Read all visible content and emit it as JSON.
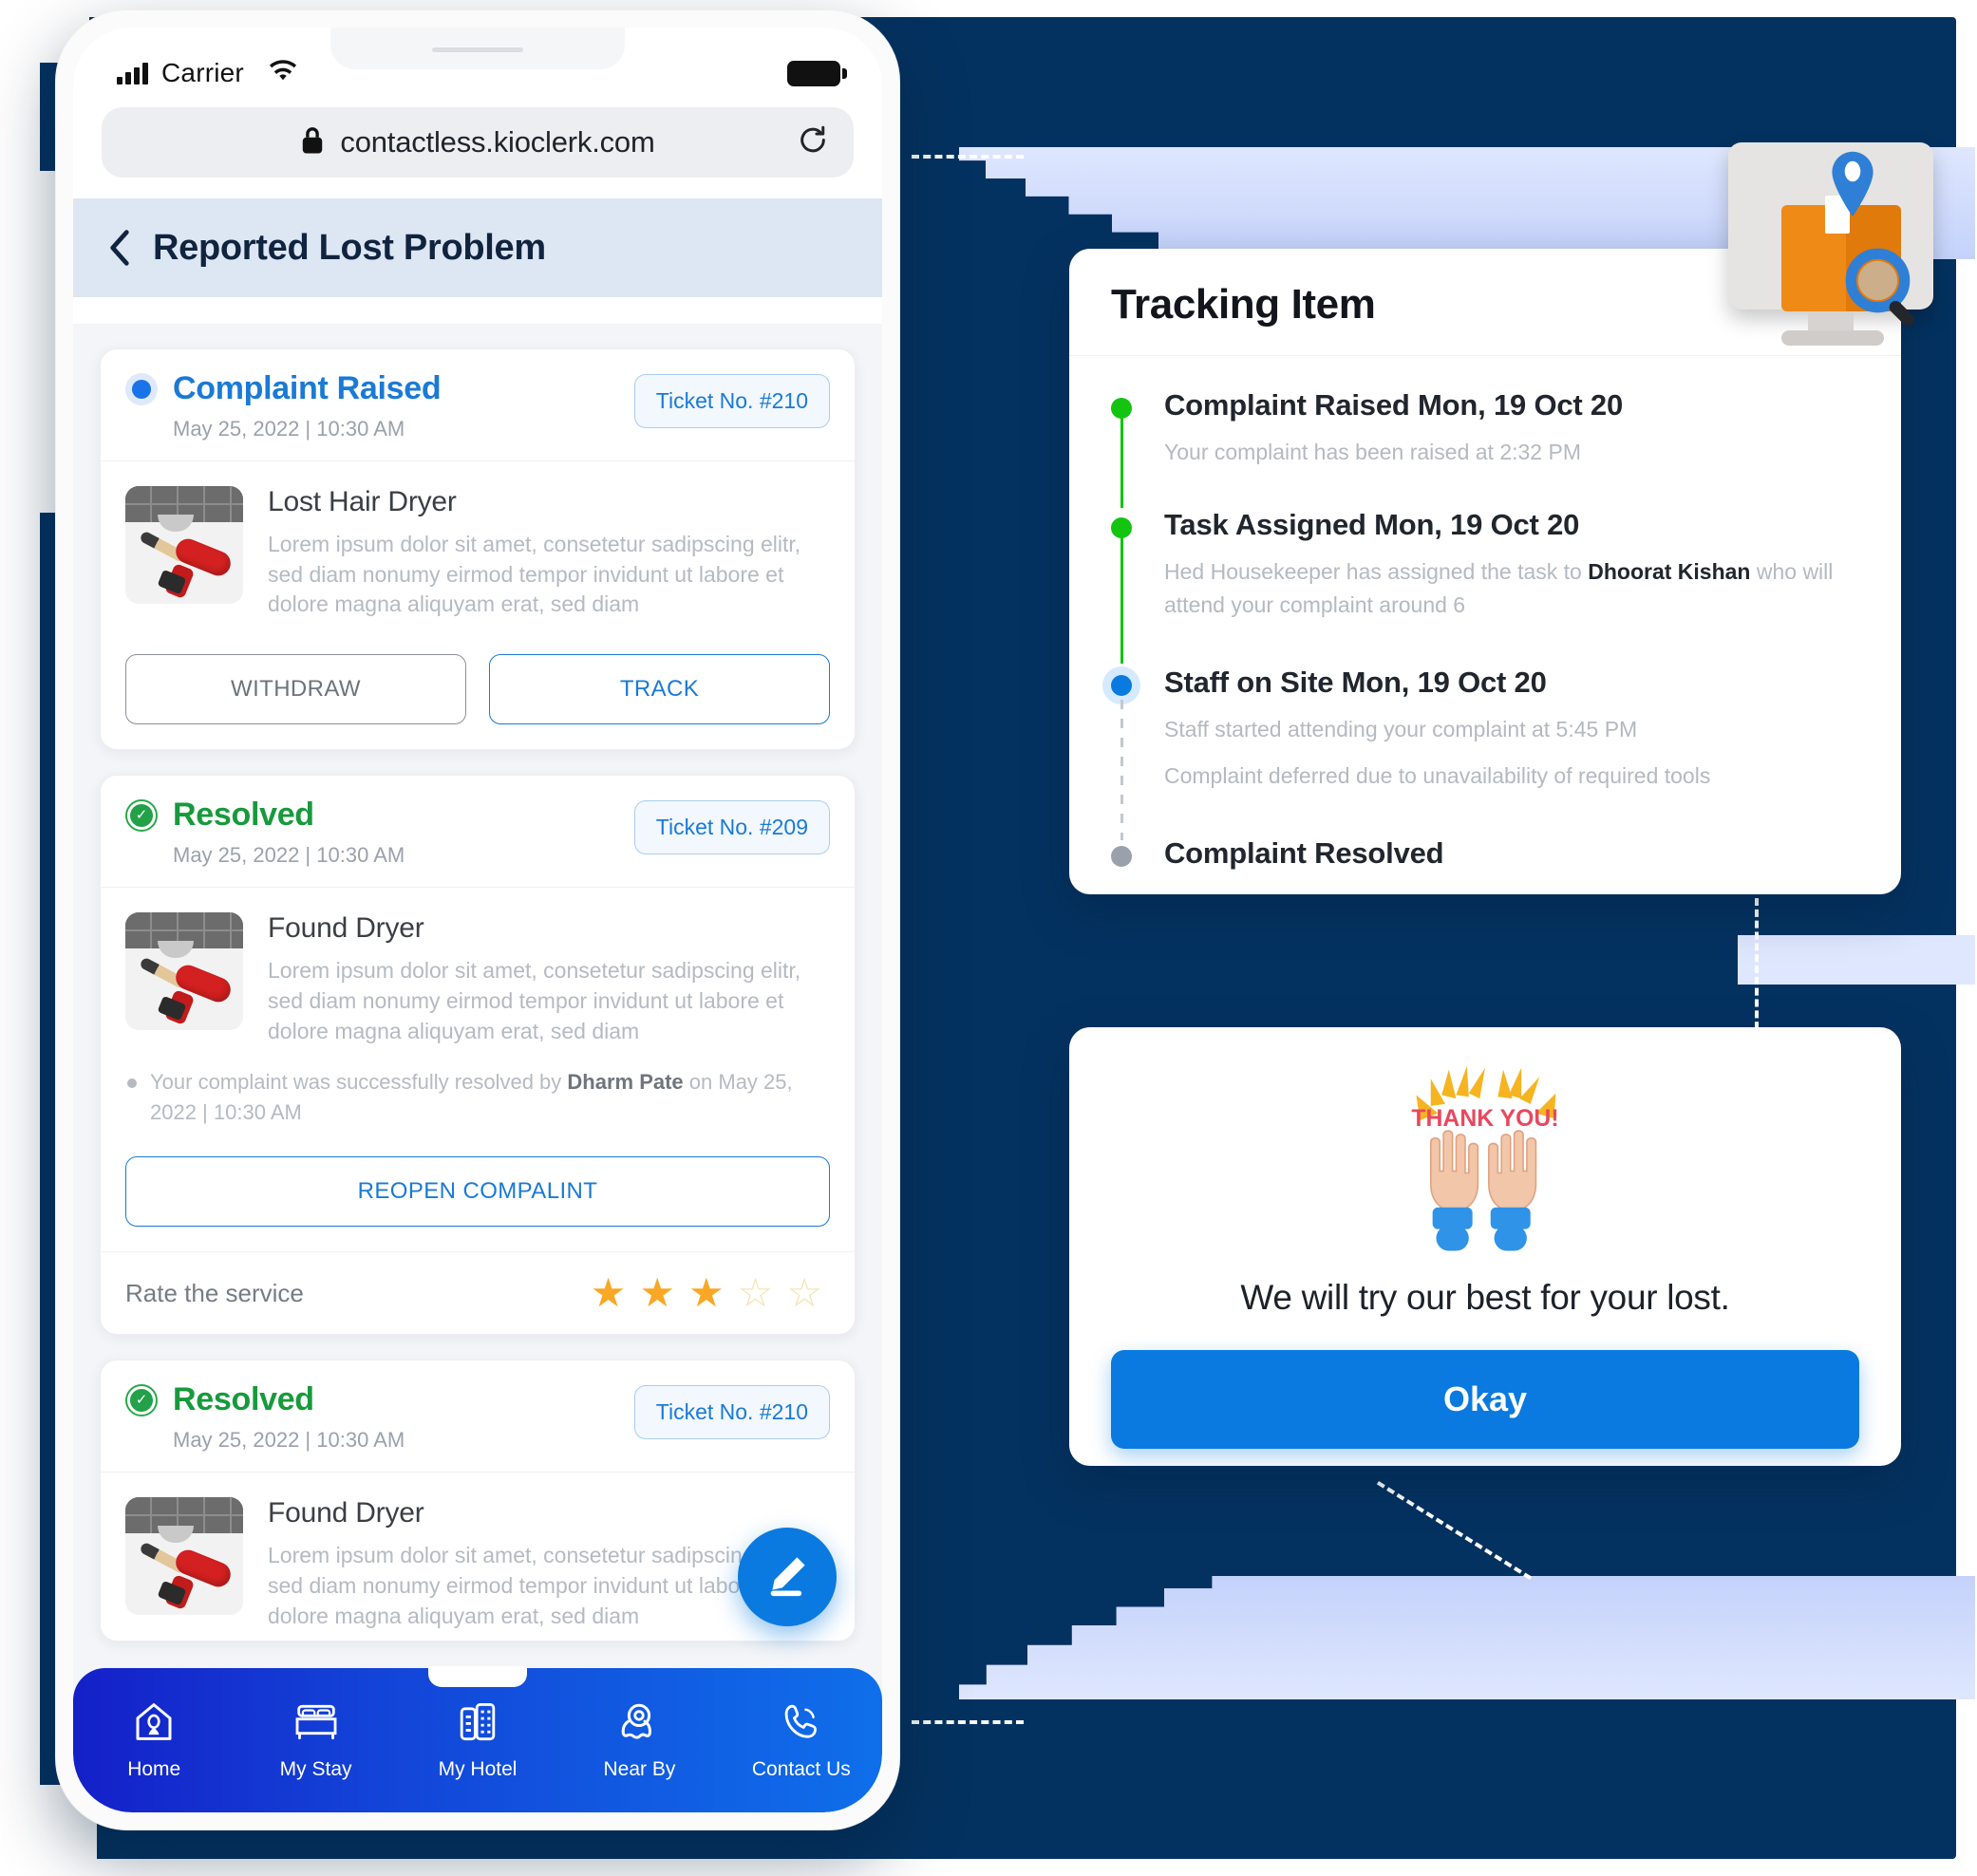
{
  "phone": {
    "status_bar": {
      "carrier": "Carrier",
      "signal_icon": "signal-bars-icon",
      "wifi_icon": "wifi-icon",
      "battery_icon": "battery-full-icon"
    },
    "browser": {
      "url": "contactless.kioclerk.com",
      "lock_icon": "lock-icon",
      "reload_icon": "reload-icon"
    },
    "header": {
      "back_icon": "chevron-left-icon",
      "title": "Reported Lost Problem"
    },
    "cards": [
      {
        "status": "Complaint Raised",
        "status_type": "raised",
        "date": "May 25, 2022 | 10:30 AM",
        "ticket": "Ticket No. #210",
        "item_title": "Lost Hair Dryer",
        "item_desc": "Lorem ipsum dolor sit amet, consetetur sadipscing elitr, sed diam nonumy eirmod tempor invidunt ut labore et dolore magna aliquyam erat, sed diam",
        "buttons": {
          "secondary": "WITHDRAW",
          "primary": "TRACK"
        }
      },
      {
        "status": "Resolved",
        "status_type": "resolved",
        "date": "May 25, 2022 | 10:30 AM",
        "ticket": "Ticket No. #209",
        "item_title": "Found Dryer",
        "item_desc": "Lorem ipsum dolor sit amet, consetetur sadipscing elitr, sed diam nonumy eirmod tempor invidunt ut labore et dolore magna aliquyam erat, sed diam",
        "note_pre": "Your complaint was successfully resolved by ",
        "note_name": "Dharm Pate",
        "note_post": " on May 25, 2022 | 10:30 AM",
        "reopen_label": "REOPEN COMPALINT",
        "rate_label": "Rate the service",
        "rating": 3,
        "rating_max": 5
      },
      {
        "status": "Resolved",
        "status_type": "resolved",
        "date": "May 25, 2022 | 10:30 AM",
        "ticket": "Ticket No. #210",
        "item_title": "Found Dryer",
        "item_desc": "Lorem ipsum dolor sit amet, consetetur sadipscing elitr, sed diam nonumy eirmod tempor invidunt ut labore et dolore magna aliquyam erat, sed diam"
      }
    ],
    "fab": {
      "icon": "edit-pencil-icon"
    },
    "bottom_nav": [
      {
        "label": "Home",
        "icon": "home-pin-icon"
      },
      {
        "label": "My Stay",
        "icon": "bed-icon"
      },
      {
        "label": "My Hotel",
        "icon": "buildings-icon"
      },
      {
        "label": "Near By",
        "icon": "location-pin-icon"
      },
      {
        "label": "Contact Us",
        "icon": "phone-icon"
      }
    ]
  },
  "tracking_panel": {
    "title": "Tracking Item",
    "icon": "package-tracking-icon",
    "steps": [
      {
        "title": "Complaint Raised Mon, 19 Oct 20",
        "marker": "green",
        "lines": [
          "Your complaint has been raised at 2:32 PM"
        ]
      },
      {
        "title": "Task Assigned Mon, 19 Oct 20",
        "marker": "green",
        "line_pre": "Hed Housekeeper has assigned the task to ",
        "line_name": "Dhoorat Kishan",
        "line_post": " who will attend your complaint around 6",
        "lines": []
      },
      {
        "title": "Staff on Site Mon, 19 Oct 20",
        "marker": "blue",
        "lines": [
          "Staff started attending your complaint at 5:45 PM",
          "Complaint deferred due to unavailability of required tools"
        ]
      },
      {
        "title": "Complaint Resolved",
        "marker": "gray",
        "lines": []
      }
    ]
  },
  "thanks_panel": {
    "art_icon": "raising-hands-thank-you-icon",
    "art_text": "THANK YOU!",
    "message": "We will try our best for your lost.",
    "button_label": "Okay"
  },
  "colors": {
    "navy": "#043260",
    "accent_blue": "#0a7ae0",
    "link_blue": "#1a7ad6",
    "green": "#13c510",
    "resolved_green": "#179a3c",
    "star_on": "#f9a825",
    "star_off": "#f6e3b0",
    "ribbon": "#cdd9fb"
  }
}
